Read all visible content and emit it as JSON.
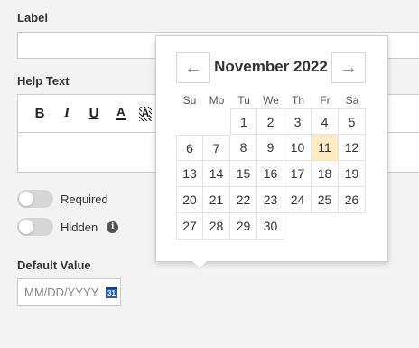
{
  "form": {
    "label_heading": "Label",
    "label_value": "",
    "help_text_heading": "Help Text",
    "toolbar": {
      "bold": "B",
      "italic": "I",
      "underline": "U",
      "text_color": "A",
      "highlight": "A"
    },
    "toggles": [
      {
        "label": "Required",
        "on": false
      },
      {
        "label": "Hidden",
        "on": false
      }
    ],
    "info_symbol": "i",
    "default_value_heading": "Default Value",
    "date_placeholder": "MM/DD/YYYY",
    "calendar_icon_text": "31"
  },
  "picker": {
    "prev_arrow": "←",
    "next_arrow": "→",
    "month_title": "November 2022",
    "weekdays": [
      "Su",
      "Mo",
      "Tu",
      "We",
      "Th",
      "Fr",
      "Sa"
    ],
    "leading_blanks": 2,
    "days_in_month": 30,
    "highlighted_day": 11
  },
  "colors": {
    "highlight": "#fdebc3",
    "calendar_icon": "#1f5fbf"
  },
  "icons": {
    "prev": "arrow-left-icon",
    "next": "arrow-right-icon",
    "info": "info-icon",
    "calendar": "calendar-icon"
  }
}
